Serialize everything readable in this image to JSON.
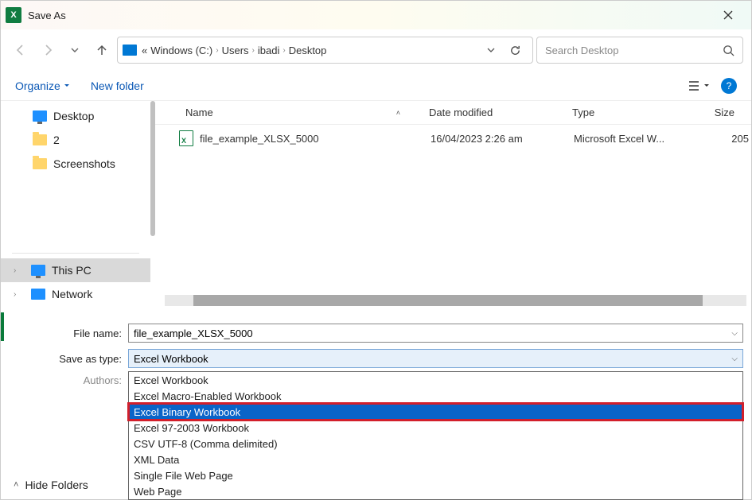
{
  "window": {
    "title": "Save As"
  },
  "nav": {
    "breadcrumb_prefix": "«",
    "crumbs": [
      "Windows (C:)",
      "Users",
      "ibadi",
      "Desktop"
    ]
  },
  "search": {
    "placeholder": "Search Desktop"
  },
  "toolbar": {
    "organize": "Organize",
    "newfolder": "New folder"
  },
  "tree": {
    "items": [
      {
        "label": "Desktop",
        "icon": "monitor"
      },
      {
        "label": "2",
        "icon": "folder"
      },
      {
        "label": "Screenshots",
        "icon": "folder"
      }
    ],
    "bottom": [
      {
        "label": "This PC",
        "icon": "monitor",
        "expandable": true,
        "selected": true
      },
      {
        "label": "Network",
        "icon": "network",
        "expandable": true
      }
    ]
  },
  "columns": {
    "name": "Name",
    "date": "Date modified",
    "type": "Type",
    "size": "Size"
  },
  "files": [
    {
      "name": "file_example_XLSX_5000",
      "date": "16/04/2023 2:26 am",
      "type": "Microsoft Excel W...",
      "size": "205"
    }
  ],
  "form": {
    "filename_label": "File name:",
    "filename_value": "file_example_XLSX_5000",
    "savetype_label": "Save as type:",
    "savetype_value": "Excel Workbook",
    "authors_label": "Authors:"
  },
  "dropdown": {
    "options": [
      "Excel Workbook",
      "Excel Macro-Enabled Workbook",
      "Excel Binary Workbook",
      "Excel 97-2003 Workbook",
      "CSV UTF-8 (Comma delimited)",
      "XML Data",
      "Single File Web Page",
      "Web Page"
    ],
    "highlighted_index": 2
  },
  "bottom": {
    "hidefolders": "Hide Folders"
  }
}
